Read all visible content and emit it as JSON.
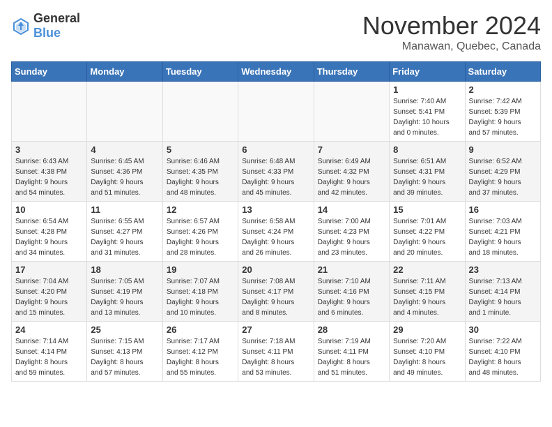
{
  "app": {
    "name_general": "General",
    "name_blue": "Blue"
  },
  "header": {
    "month": "November 2024",
    "location": "Manawan, Quebec, Canada"
  },
  "weekdays": [
    "Sunday",
    "Monday",
    "Tuesday",
    "Wednesday",
    "Thursday",
    "Friday",
    "Saturday"
  ],
  "weeks": [
    {
      "days": [
        {
          "num": "",
          "info": ""
        },
        {
          "num": "",
          "info": ""
        },
        {
          "num": "",
          "info": ""
        },
        {
          "num": "",
          "info": ""
        },
        {
          "num": "",
          "info": ""
        },
        {
          "num": "1",
          "info": "Sunrise: 7:40 AM\nSunset: 5:41 PM\nDaylight: 10 hours\nand 0 minutes."
        },
        {
          "num": "2",
          "info": "Sunrise: 7:42 AM\nSunset: 5:39 PM\nDaylight: 9 hours\nand 57 minutes."
        }
      ]
    },
    {
      "days": [
        {
          "num": "3",
          "info": "Sunrise: 6:43 AM\nSunset: 4:38 PM\nDaylight: 9 hours\nand 54 minutes."
        },
        {
          "num": "4",
          "info": "Sunrise: 6:45 AM\nSunset: 4:36 PM\nDaylight: 9 hours\nand 51 minutes."
        },
        {
          "num": "5",
          "info": "Sunrise: 6:46 AM\nSunset: 4:35 PM\nDaylight: 9 hours\nand 48 minutes."
        },
        {
          "num": "6",
          "info": "Sunrise: 6:48 AM\nSunset: 4:33 PM\nDaylight: 9 hours\nand 45 minutes."
        },
        {
          "num": "7",
          "info": "Sunrise: 6:49 AM\nSunset: 4:32 PM\nDaylight: 9 hours\nand 42 minutes."
        },
        {
          "num": "8",
          "info": "Sunrise: 6:51 AM\nSunset: 4:31 PM\nDaylight: 9 hours\nand 39 minutes."
        },
        {
          "num": "9",
          "info": "Sunrise: 6:52 AM\nSunset: 4:29 PM\nDaylight: 9 hours\nand 37 minutes."
        }
      ]
    },
    {
      "days": [
        {
          "num": "10",
          "info": "Sunrise: 6:54 AM\nSunset: 4:28 PM\nDaylight: 9 hours\nand 34 minutes."
        },
        {
          "num": "11",
          "info": "Sunrise: 6:55 AM\nSunset: 4:27 PM\nDaylight: 9 hours\nand 31 minutes."
        },
        {
          "num": "12",
          "info": "Sunrise: 6:57 AM\nSunset: 4:26 PM\nDaylight: 9 hours\nand 28 minutes."
        },
        {
          "num": "13",
          "info": "Sunrise: 6:58 AM\nSunset: 4:24 PM\nDaylight: 9 hours\nand 26 minutes."
        },
        {
          "num": "14",
          "info": "Sunrise: 7:00 AM\nSunset: 4:23 PM\nDaylight: 9 hours\nand 23 minutes."
        },
        {
          "num": "15",
          "info": "Sunrise: 7:01 AM\nSunset: 4:22 PM\nDaylight: 9 hours\nand 20 minutes."
        },
        {
          "num": "16",
          "info": "Sunrise: 7:03 AM\nSunset: 4:21 PM\nDaylight: 9 hours\nand 18 minutes."
        }
      ]
    },
    {
      "days": [
        {
          "num": "17",
          "info": "Sunrise: 7:04 AM\nSunset: 4:20 PM\nDaylight: 9 hours\nand 15 minutes."
        },
        {
          "num": "18",
          "info": "Sunrise: 7:05 AM\nSunset: 4:19 PM\nDaylight: 9 hours\nand 13 minutes."
        },
        {
          "num": "19",
          "info": "Sunrise: 7:07 AM\nSunset: 4:18 PM\nDaylight: 9 hours\nand 10 minutes."
        },
        {
          "num": "20",
          "info": "Sunrise: 7:08 AM\nSunset: 4:17 PM\nDaylight: 9 hours\nand 8 minutes."
        },
        {
          "num": "21",
          "info": "Sunrise: 7:10 AM\nSunset: 4:16 PM\nDaylight: 9 hours\nand 6 minutes."
        },
        {
          "num": "22",
          "info": "Sunrise: 7:11 AM\nSunset: 4:15 PM\nDaylight: 9 hours\nand 4 minutes."
        },
        {
          "num": "23",
          "info": "Sunrise: 7:13 AM\nSunset: 4:14 PM\nDaylight: 9 hours\nand 1 minute."
        }
      ]
    },
    {
      "days": [
        {
          "num": "24",
          "info": "Sunrise: 7:14 AM\nSunset: 4:14 PM\nDaylight: 8 hours\nand 59 minutes."
        },
        {
          "num": "25",
          "info": "Sunrise: 7:15 AM\nSunset: 4:13 PM\nDaylight: 8 hours\nand 57 minutes."
        },
        {
          "num": "26",
          "info": "Sunrise: 7:17 AM\nSunset: 4:12 PM\nDaylight: 8 hours\nand 55 minutes."
        },
        {
          "num": "27",
          "info": "Sunrise: 7:18 AM\nSunset: 4:11 PM\nDaylight: 8 hours\nand 53 minutes."
        },
        {
          "num": "28",
          "info": "Sunrise: 7:19 AM\nSunset: 4:11 PM\nDaylight: 8 hours\nand 51 minutes."
        },
        {
          "num": "29",
          "info": "Sunrise: 7:20 AM\nSunset: 4:10 PM\nDaylight: 8 hours\nand 49 minutes."
        },
        {
          "num": "30",
          "info": "Sunrise: 7:22 AM\nSunset: 4:10 PM\nDaylight: 8 hours\nand 48 minutes."
        }
      ]
    }
  ]
}
